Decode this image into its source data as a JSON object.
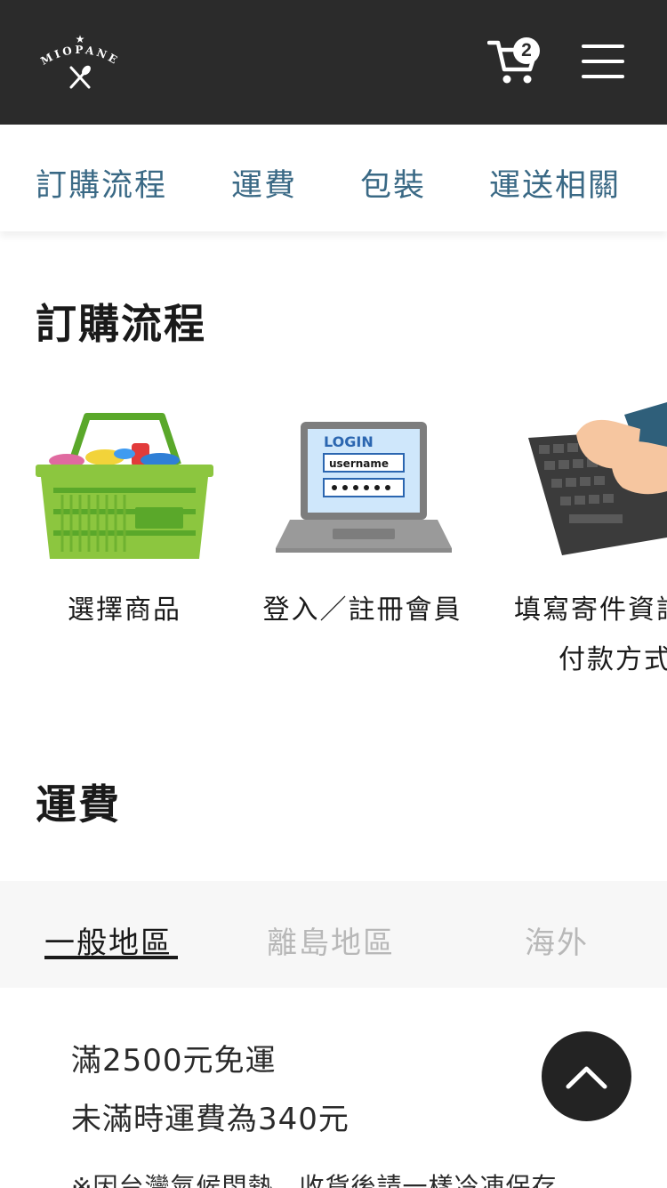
{
  "header": {
    "logo_text": "MIOPANE",
    "cart_count": "2",
    "colors": {
      "bar": "#2b2b2b",
      "nav_link": "#3a6985"
    }
  },
  "subnav": {
    "items": [
      {
        "label": "訂購流程"
      },
      {
        "label": "運費"
      },
      {
        "label": "包裝"
      },
      {
        "label": "運送相關"
      }
    ]
  },
  "order_section": {
    "title": "訂購流程",
    "steps": [
      {
        "label": "選擇商品",
        "icon": "shopping-basket-illustration"
      },
      {
        "label": "登入／註冊會員",
        "icon": "laptop-login-illustration",
        "screen_title": "LOGIN",
        "field_user": "username"
      },
      {
        "label_line1": "填寫寄件資訊",
        "label_line2": "付款方式",
        "icon": "typing-keyboard-illustration"
      }
    ]
  },
  "shipping_section": {
    "title": "運費",
    "tabs": [
      {
        "label": "一般地區",
        "active": true
      },
      {
        "label": "離島地區",
        "active": false
      },
      {
        "label": "海外",
        "active": false
      }
    ],
    "line1": "滿2500元免運",
    "line2": "未滿時運費為340元",
    "note": "※因台灣氣候悶熱，收貨後請一樣冷凍保存，"
  },
  "back_to_top": {
    "icon": "chevron-up-icon"
  }
}
